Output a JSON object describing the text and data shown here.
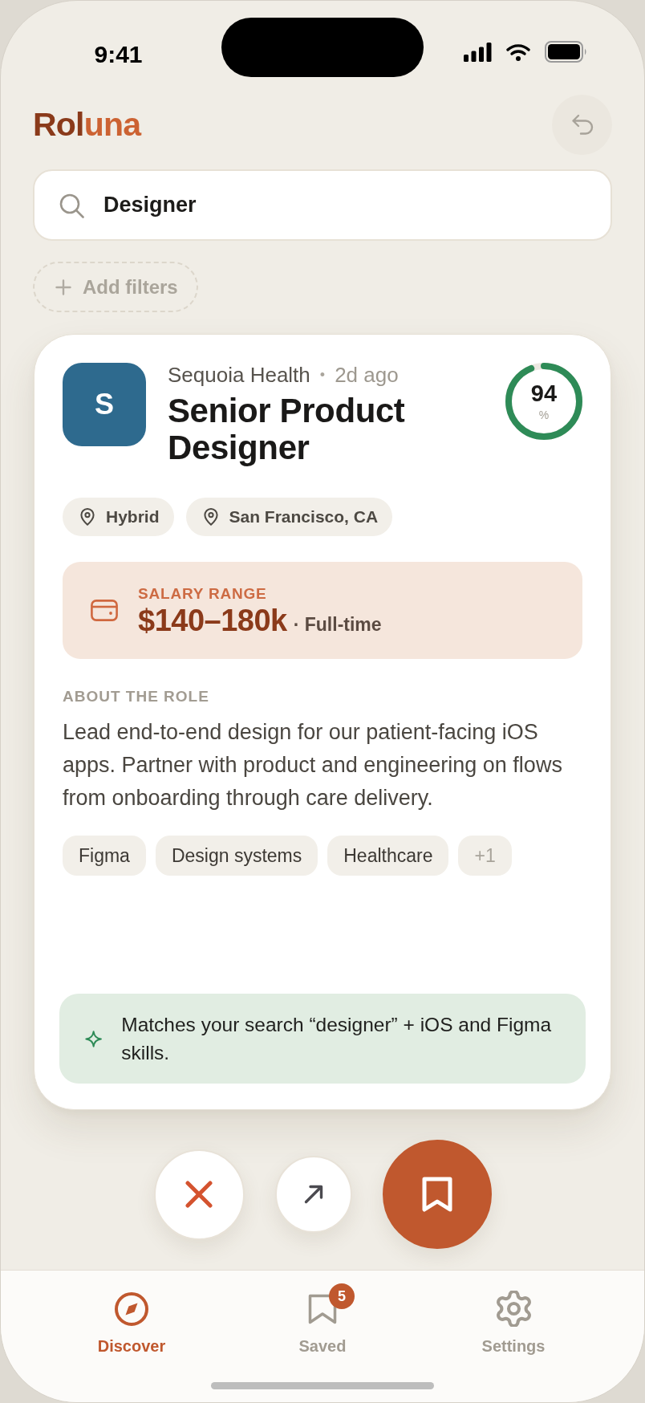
{
  "status_bar": {
    "time": "9:41"
  },
  "header": {
    "logo": {
      "main": "Rol",
      "accent": "una"
    }
  },
  "search": {
    "value": "Designer"
  },
  "filters": {
    "label": "Add filters"
  },
  "job": {
    "company_initial": "S",
    "company": "Sequoia Health",
    "separator": "•",
    "posted": "2d ago",
    "title": "Senior Product Designer",
    "match": {
      "value": "94",
      "unit": "%",
      "level": 0.94
    },
    "tags": [
      "Hybrid",
      "San Francisco, CA"
    ],
    "salary": {
      "label": "SALARY RANGE",
      "amount": "$140–180k",
      "detail": "· Full-time"
    },
    "about": {
      "heading": "ABOUT THE ROLE",
      "text": "Lead end-to-end design for our patient-facing iOS apps. Partner with product and engineering on flows from onboarding through care delivery."
    },
    "skills": [
      {
        "label": "Figma",
        "kind": "skill"
      },
      {
        "label": "Design systems",
        "kind": "skill"
      },
      {
        "label": "Healthcare",
        "kind": "skill"
      },
      {
        "label": "+1",
        "kind": "more"
      }
    ],
    "match_reason": "Matches your search “designer” + iOS and Figma skills."
  },
  "actions": [
    {
      "kind": "dismiss"
    },
    {
      "kind": "open"
    },
    {
      "kind": "save"
    }
  ],
  "nav": {
    "tabs": [
      {
        "kind": "discover",
        "label": "Discover",
        "selected": true
      },
      {
        "kind": "saved",
        "label": "Saved",
        "selected": false,
        "badge": "5"
      },
      {
        "kind": "settings",
        "label": "Settings",
        "selected": false
      }
    ]
  }
}
